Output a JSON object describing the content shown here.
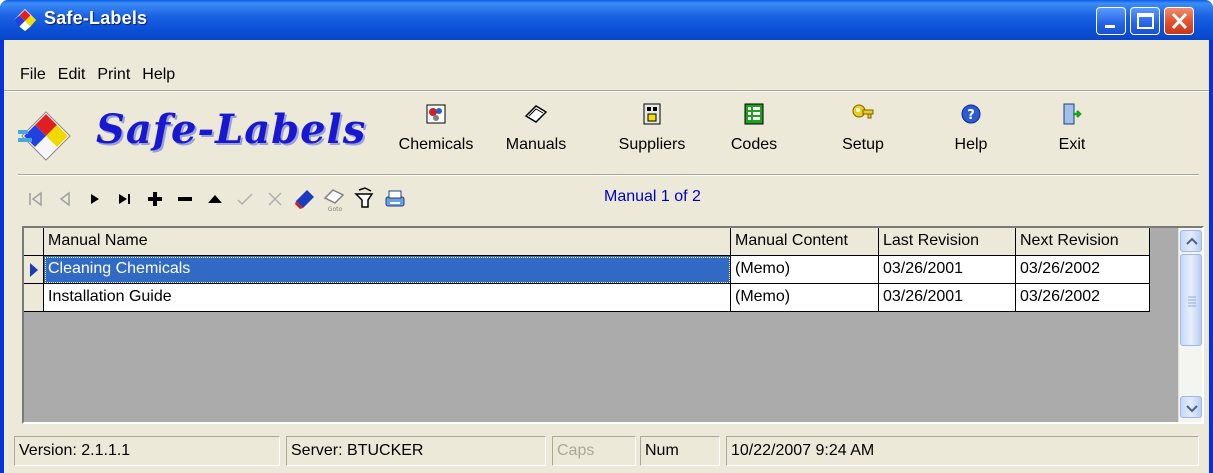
{
  "window": {
    "title": "Safe-Labels"
  },
  "menu": {
    "items": [
      "File",
      "Edit",
      "Print",
      "Help"
    ]
  },
  "logo": {
    "text": "Safe-Labels"
  },
  "toolbar": {
    "buttons": [
      {
        "label": "Chemicals",
        "icon": "chemicals-icon"
      },
      {
        "label": "Manuals",
        "icon": "manuals-icon"
      },
      {
        "label": "Suppliers",
        "icon": "suppliers-icon"
      },
      {
        "label": "Codes",
        "icon": "codes-icon"
      },
      {
        "label": "Setup",
        "icon": "setup-key-icon"
      },
      {
        "label": "Help",
        "icon": "help-icon"
      },
      {
        "label": "Exit",
        "icon": "exit-door-icon"
      }
    ]
  },
  "navigator": {
    "position_text": "Manual 1 of 2",
    "buttons": [
      "first",
      "prior",
      "next",
      "last",
      "insert",
      "delete",
      "edit",
      "post",
      "cancel",
      "refresh",
      "goto",
      "filter",
      "print"
    ]
  },
  "grid": {
    "columns": [
      "Manual Name",
      "Manual Content",
      "Last Revision",
      "Next Revision"
    ],
    "rows": [
      {
        "name": "Cleaning Chemicals",
        "content": "(Memo)",
        "last": "03/26/2001",
        "next": "03/26/2002",
        "selected": true
      },
      {
        "name": "Installation Guide",
        "content": "(Memo)",
        "last": "03/26/2001",
        "next": "03/26/2002",
        "selected": false
      }
    ]
  },
  "status": {
    "version": "Version: 2.1.1.1",
    "server": "Server: BTUCKER",
    "caps": "Caps",
    "num": "Num",
    "datetime": "10/22/2007 9:24 AM"
  },
  "colors": {
    "title_blue": "#0a4fd6",
    "selection": "#316ac5",
    "logo_text": "#1818d0",
    "nav_text": "#0000cc"
  }
}
